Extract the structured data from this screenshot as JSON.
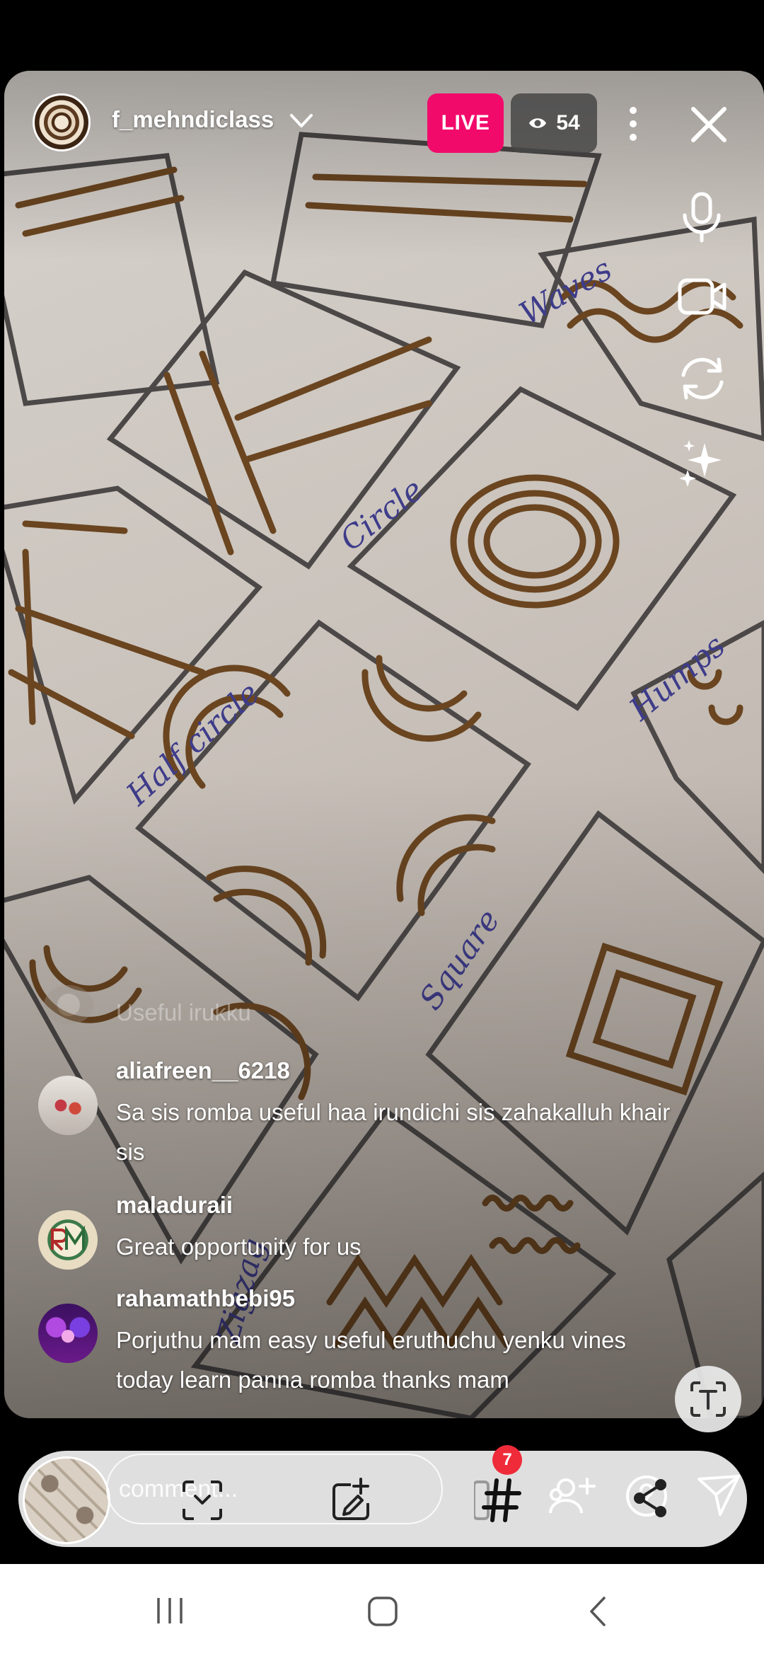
{
  "header": {
    "username": "f_mehndiclass",
    "live_label": "LIVE",
    "viewer_count": "54"
  },
  "comments": {
    "faded": {
      "text": "Useful irukku"
    },
    "items": [
      {
        "user": "aliafreen__6218",
        "text": "Sa sis romba useful haa irundichi sis zahakalluh khair sis"
      },
      {
        "user": "maladuraii",
        "text": "Great opportunity for us"
      },
      {
        "user": "rahamathbebi95",
        "text": "Porjuthu mam easy useful eruthuchu yenku vines today learn panna romba thanks mam"
      }
    ]
  },
  "composer": {
    "placeholder": "comment...",
    "hashtag_badge": "7"
  },
  "icons": {
    "top": [
      "chevron-down-icon",
      "eye-icon",
      "more-vertical-icon",
      "close-icon"
    ],
    "side": [
      "microphone-icon",
      "video-camera-icon",
      "flip-camera-icon",
      "sparkles-effects-icon"
    ],
    "bar": [
      "scan-icon",
      "add-sticker-icon",
      "hashtag-icon",
      "add-guest-icon",
      "question-icon",
      "share-icon",
      "send-icon"
    ],
    "nav": [
      "recent-apps-icon",
      "home-icon",
      "back-icon"
    ]
  },
  "colors": {
    "live": "#f20a6b",
    "badge": "#ef2b3a"
  }
}
